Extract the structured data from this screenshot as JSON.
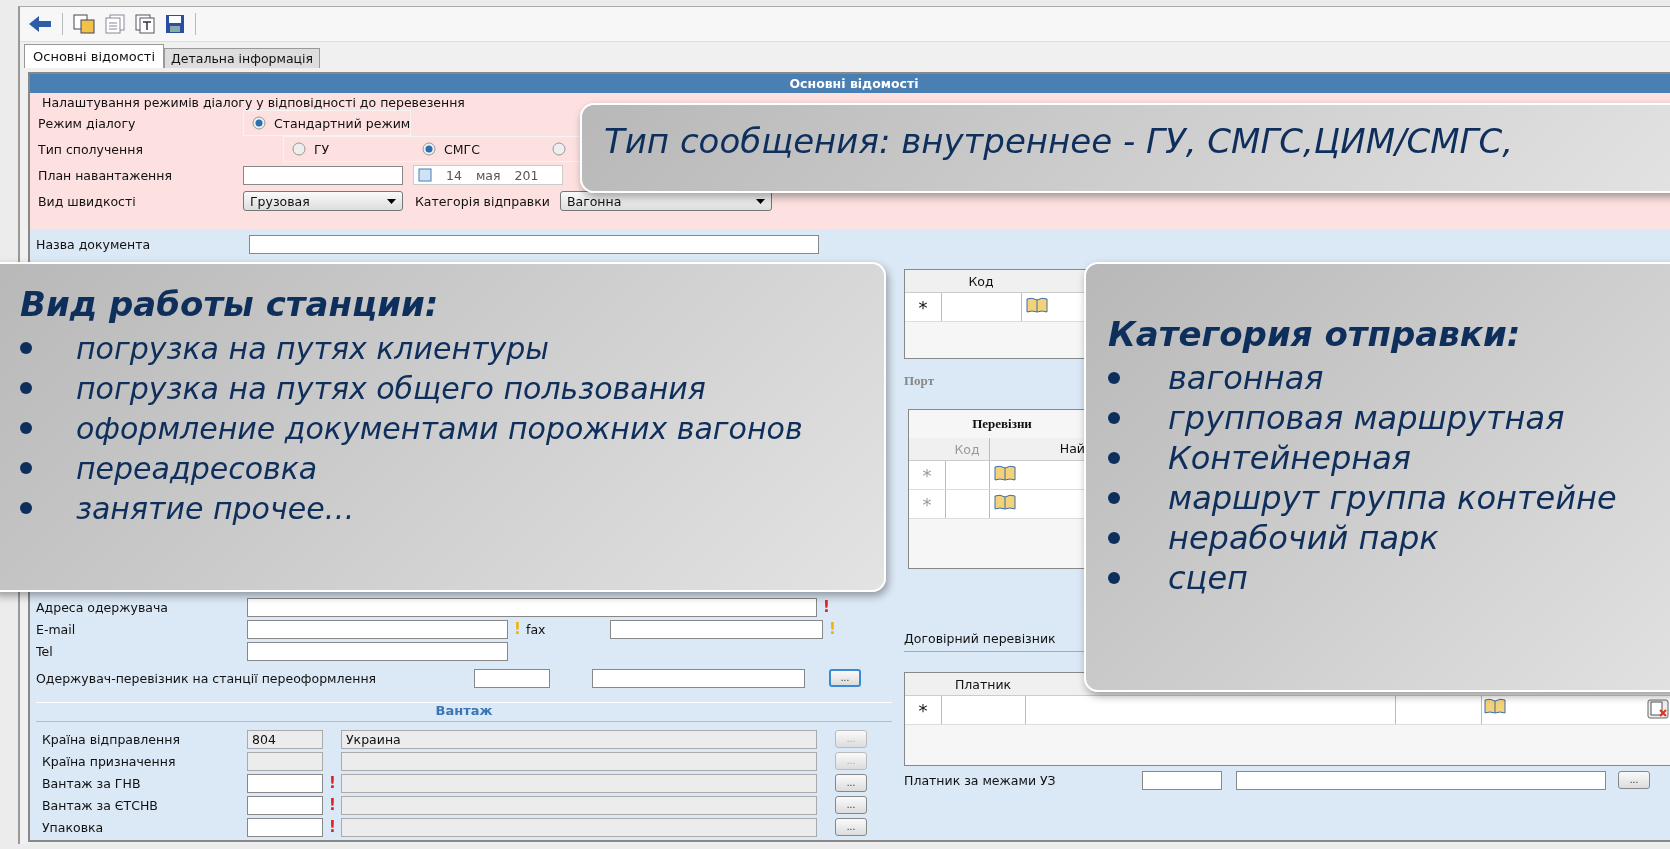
{
  "tabs": [
    {
      "label": "Основні відомості",
      "selected": true
    },
    {
      "label": "Детальна інформація",
      "selected": false
    }
  ],
  "section_title": "Основні відомості",
  "dialog_settings": {
    "legend": "Налаштування режимів діалогу у відповідності до перевезення",
    "mode_label": "Режим діалогу",
    "mode_options": [
      {
        "label": "Стандартний режим",
        "selected": true
      }
    ],
    "connection_label": "Тип сполучення",
    "connection_options": [
      {
        "label": "ГУ",
        "selected": false
      },
      {
        "label": "СМГС",
        "selected": true
      },
      {
        "selected": false
      }
    ],
    "plan_label": "План навантаження",
    "plan_date": {
      "checked": false,
      "day": "14",
      "month": "мая",
      "year": "201"
    },
    "speed_label": "Вид швидкості",
    "speed_value": "Грузовая",
    "category_label": "Категорія відправки",
    "category_value": "Вагонна"
  },
  "document_name_label": "Назва документа",
  "recipient": {
    "address": {
      "label": "Адреса одержувача",
      "flag": {
        "kind": "error",
        "text": "!"
      }
    },
    "email": {
      "label": "E-mail",
      "flag": {
        "kind": "warning",
        "text": "!"
      }
    },
    "fax": {
      "label": "fax",
      "flag": {
        "kind": "warning",
        "text": "!"
      }
    },
    "tel": {
      "label": "Tel"
    },
    "carrier": {
      "label": "Одержувач-перевізник на станції переоформлення",
      "button": "..."
    }
  },
  "cargo": {
    "title": "Вантаж",
    "rows": [
      {
        "label": "Країна відправлення",
        "code": "804",
        "name": "Украина",
        "disabled": true,
        "button": "..."
      },
      {
        "label": "Країна призначення",
        "disabled": true,
        "button": "..."
      },
      {
        "label": "Вантаж за ГНВ",
        "disabled": false,
        "flag": {
          "kind": "error",
          "text": "!"
        },
        "button": "..."
      },
      {
        "label": "Вантаж за ЄТСНВ",
        "disabled": false,
        "flag": {
          "kind": "error",
          "text": "!"
        },
        "button": "..."
      },
      {
        "label": "Упаковка",
        "disabled": false,
        "flag": {
          "kind": "error",
          "text": "!"
        },
        "button": "..."
      }
    ]
  },
  "routes_table": {
    "columns": [
      "Код"
    ],
    "rows": [
      {
        "marker": "*"
      }
    ]
  },
  "port_label": "Порт",
  "carriers_table": {
    "title": "Перевізни",
    "columns": [
      "Код",
      "Най"
    ],
    "rows": [
      {
        "marker": "*"
      },
      {
        "marker": "*"
      }
    ]
  },
  "contract_carrier_label": "Договірний перевізник",
  "payers_table": {
    "columns": [
      "Платник"
    ],
    "rows": [
      {
        "marker": "*"
      }
    ]
  },
  "payer_outside": {
    "label": "Платник за межами УЗ",
    "button": "..."
  },
  "callouts": {
    "top": {
      "text": "Тип сообщения: внутреннее - ГУ, СМГС,ЦИМ/СМГС,"
    },
    "left": {
      "title": "Вид работы станции:",
      "items": [
        "погрузка на путях клиентуры",
        "погрузка на путях общего пользования",
        "оформление документами порожних вагонов",
        "переадресовка",
        "занятие прочее…"
      ]
    },
    "right": {
      "title": "Категория отправки:",
      "items": [
        "вагонная",
        "групповая маршрутная",
        "Контейнерная",
        "маршрут группа контейне",
        "нерабочий парк",
        "сцеп"
      ]
    }
  }
}
